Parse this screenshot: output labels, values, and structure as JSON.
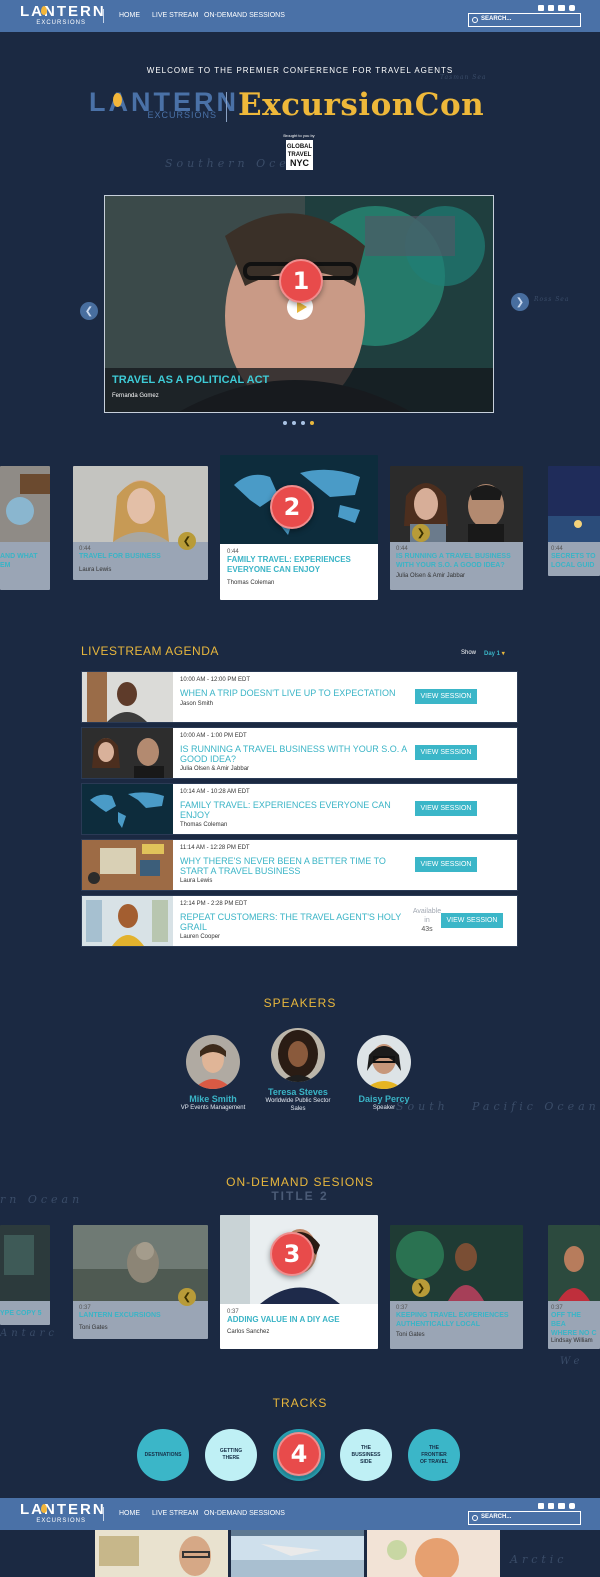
{
  "nav": {
    "logo_word": "LANTERN",
    "logo_sub": "EXCURSIONS",
    "links": [
      "HOME",
      "LIVE STREAM",
      "ON-DEMAND SESSIONS"
    ],
    "search_placeholder": "SEARCH...",
    "social": [
      "facebook-icon",
      "twitter-icon",
      "youtube-icon",
      "instagram-icon"
    ]
  },
  "hero": {
    "welcome": "WELCOME TO THE PREMIER CONFERENCE FOR TRAVEL AGENTS",
    "logo_word": "LANTERN",
    "logo_sub": "EXCURSIONS",
    "event_name": "ExcursionCon",
    "brought_by": "Brought to you by",
    "sponsor": [
      "GLOBAL",
      "TRAVEL",
      "NYC"
    ]
  },
  "map_labels": {
    "southern_ocean": "Southern Oce",
    "south": "South",
    "pacific": "Pacific Ocean",
    "rn_ocean": "rn Ocean",
    "antarc": "Antarc",
    "arctic": "Arctic",
    "we": "We",
    "ross": "Ross Sea",
    "tasman": "Tasman Sea"
  },
  "featured": {
    "title": "TRAVEL AS A POLITICAL ACT",
    "speaker": "Fernanda Gomez",
    "marker": "1",
    "dots": 4,
    "active_dot": 4
  },
  "carousel1": {
    "marker": "2",
    "cards": [
      {
        "title_lines": [
          "AND WHAT",
          "EM"
        ],
        "time": "",
        "author": ""
      },
      {
        "time": "0:44",
        "title": "TRAVEL FOR BUSINESS",
        "author": "Laura Lewis"
      },
      {
        "time": "0:44",
        "title": "FAMILY TRAVEL: EXPERIENCES EVERYONE CAN ENJOY",
        "author": "Thomas Coleman"
      },
      {
        "time": "0:44",
        "title": "IS RUNNING A TRAVEL BUSINESS WITH YOUR S.O. A GOOD IDEA?",
        "author": "Julia Olsen & Amir Jabbar"
      },
      {
        "time": "0:44",
        "title": "SECRETS TO LOCAL GUID",
        "author": ""
      }
    ]
  },
  "agenda": {
    "title": "LIVESTREAM AGENDA",
    "show_label": "Show",
    "day_select": "Day 1",
    "button_label": "VIEW SESSION",
    "rows": [
      {
        "time": "10:00 AM - 12:00 PM EDT",
        "title": "WHEN A TRIP DOESN'T LIVE UP TO EXPECTATION",
        "author": "Jason Smith"
      },
      {
        "time": "10:00 AM - 1:00 PM EDT",
        "title": "IS RUNNING A TRAVEL BUSINESS WITH YOUR S.O. A GOOD IDEA?",
        "author": "Julia Olsen & Amir Jabbar"
      },
      {
        "time": "10:14 AM - 10:28 AM EDT",
        "title": "FAMILY TRAVEL: EXPERIENCES EVERYONE CAN ENJOY",
        "author": "Thomas Coleman"
      },
      {
        "time": "11:14 AM - 12:28 PM EDT",
        "title": "WHY THERE'S NEVER BEEN A BETTER TIME TO START A TRAVEL BUSINESS",
        "author": "Laura Lewis"
      },
      {
        "time": "12:14 PM - 2:28 PM EDT",
        "title": "REPEAT CUSTOMERS: THE TRAVEL AGENT'S HOLY GRAIL",
        "author": "Lauren Cooper",
        "available": [
          "Available",
          "in",
          "43s"
        ]
      }
    ]
  },
  "speakers": {
    "title": "SPEAKERS",
    "items": [
      {
        "name": "Mike Smith",
        "role": [
          "VP Events Management"
        ]
      },
      {
        "name": "Teresa Steves",
        "role": [
          "Worldwide Public Sector",
          "Sales"
        ]
      },
      {
        "name": "Daisy Percy",
        "role": [
          "Speaker"
        ]
      }
    ]
  },
  "ondemand": {
    "title": "ON-DEMAND SESIONS",
    "ghost": "TITLE 2",
    "marker": "3",
    "cards": [
      {
        "time": "",
        "title": "YPE COPY 5",
        "author": ""
      },
      {
        "time": "0:37",
        "title": "LANTERN EXCURSIONS",
        "author": "Toni Gates"
      },
      {
        "time": "0:37",
        "title": "ADDING VALUE IN A DIY AGE",
        "author": "Carlos Sanchez"
      },
      {
        "time": "0:37",
        "title": "KEEPING TRAVEL EXPERIENCES AUTHENTICALLY LOCAL",
        "author": "Toni Gates"
      },
      {
        "time": "0:37",
        "title_lines": [
          "OFF THE BEA",
          "WHERE NO C"
        ],
        "author": "Lindsay William"
      }
    ]
  },
  "tracks": {
    "title": "TRACKS",
    "marker": "4",
    "items": [
      {
        "lines": [
          "DESTINATIONS"
        ]
      },
      {
        "lines": [
          "GETTING",
          "THERE"
        ]
      },
      {
        "lines": [
          ""
        ]
      },
      {
        "lines": [
          "THE",
          "BUSSINESS",
          "SIDE"
        ]
      },
      {
        "lines": [
          "THE",
          "FRONTIER",
          "OF TRAVEL"
        ]
      }
    ]
  },
  "colors": {
    "background": "#1b2942",
    "nav": "#4a71a7",
    "accent_teal": "#3ab4c6",
    "accent_gold": "#e8b73d",
    "marker_red": "#e84b4b"
  }
}
